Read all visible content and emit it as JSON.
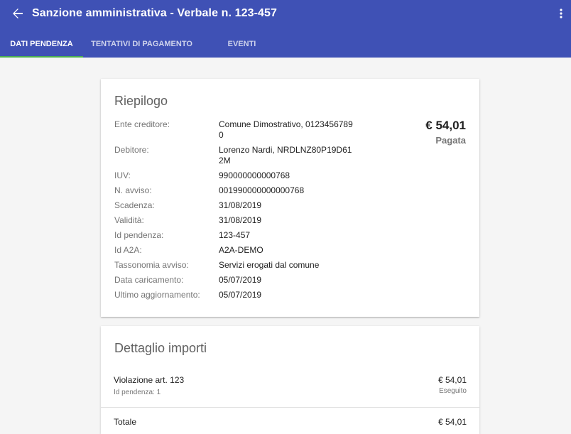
{
  "header": {
    "title": "Sanzione amministrativa - Verbale n. 123-457",
    "back_icon": "arrow-left-icon",
    "more_icon": "more-vert-icon",
    "color": "#3f51b5"
  },
  "tabs": [
    {
      "label": "DATI PENDENZA",
      "active": true
    },
    {
      "label": "TENTATIVI DI PAGAMENTO",
      "active": false
    },
    {
      "label": "EVENTI",
      "active": false
    }
  ],
  "riepilogo": {
    "title": "Riepilogo",
    "amount": "€ 54,01",
    "status": "Pagata",
    "rows": [
      {
        "label": "Ente creditore:",
        "value": "Comune Dimostrativo, 01234567890"
      },
      {
        "label": "Debitore:",
        "value": "Lorenzo Nardi, NRDLNZ80P19D612M"
      },
      {
        "label": "IUV:",
        "value": "990000000000768"
      },
      {
        "label": "N. avviso:",
        "value": "001990000000000768"
      },
      {
        "label": "Scadenza:",
        "value": "31/08/2019"
      },
      {
        "label": "Validità:",
        "value": "31/08/2019"
      },
      {
        "label": "Id pendenza:",
        "value": "123-457"
      },
      {
        "label": "Id A2A:",
        "value": "A2A-DEMO"
      },
      {
        "label": "Tassonomia avviso:",
        "value": "Servizi erogati dal comune"
      },
      {
        "label": "Data caricamento:",
        "value": "05/07/2019"
      },
      {
        "label": "Ultimo aggiornamento:",
        "value": "05/07/2019"
      }
    ]
  },
  "dettaglio": {
    "title": "Dettaglio importi",
    "items": [
      {
        "description": "Violazione art. 123",
        "sub": "Id pendenza: 1",
        "amount": "€ 54,01",
        "status": "Eseguito"
      }
    ],
    "total_label": "Totale",
    "total_amount": "€ 54,01"
  }
}
